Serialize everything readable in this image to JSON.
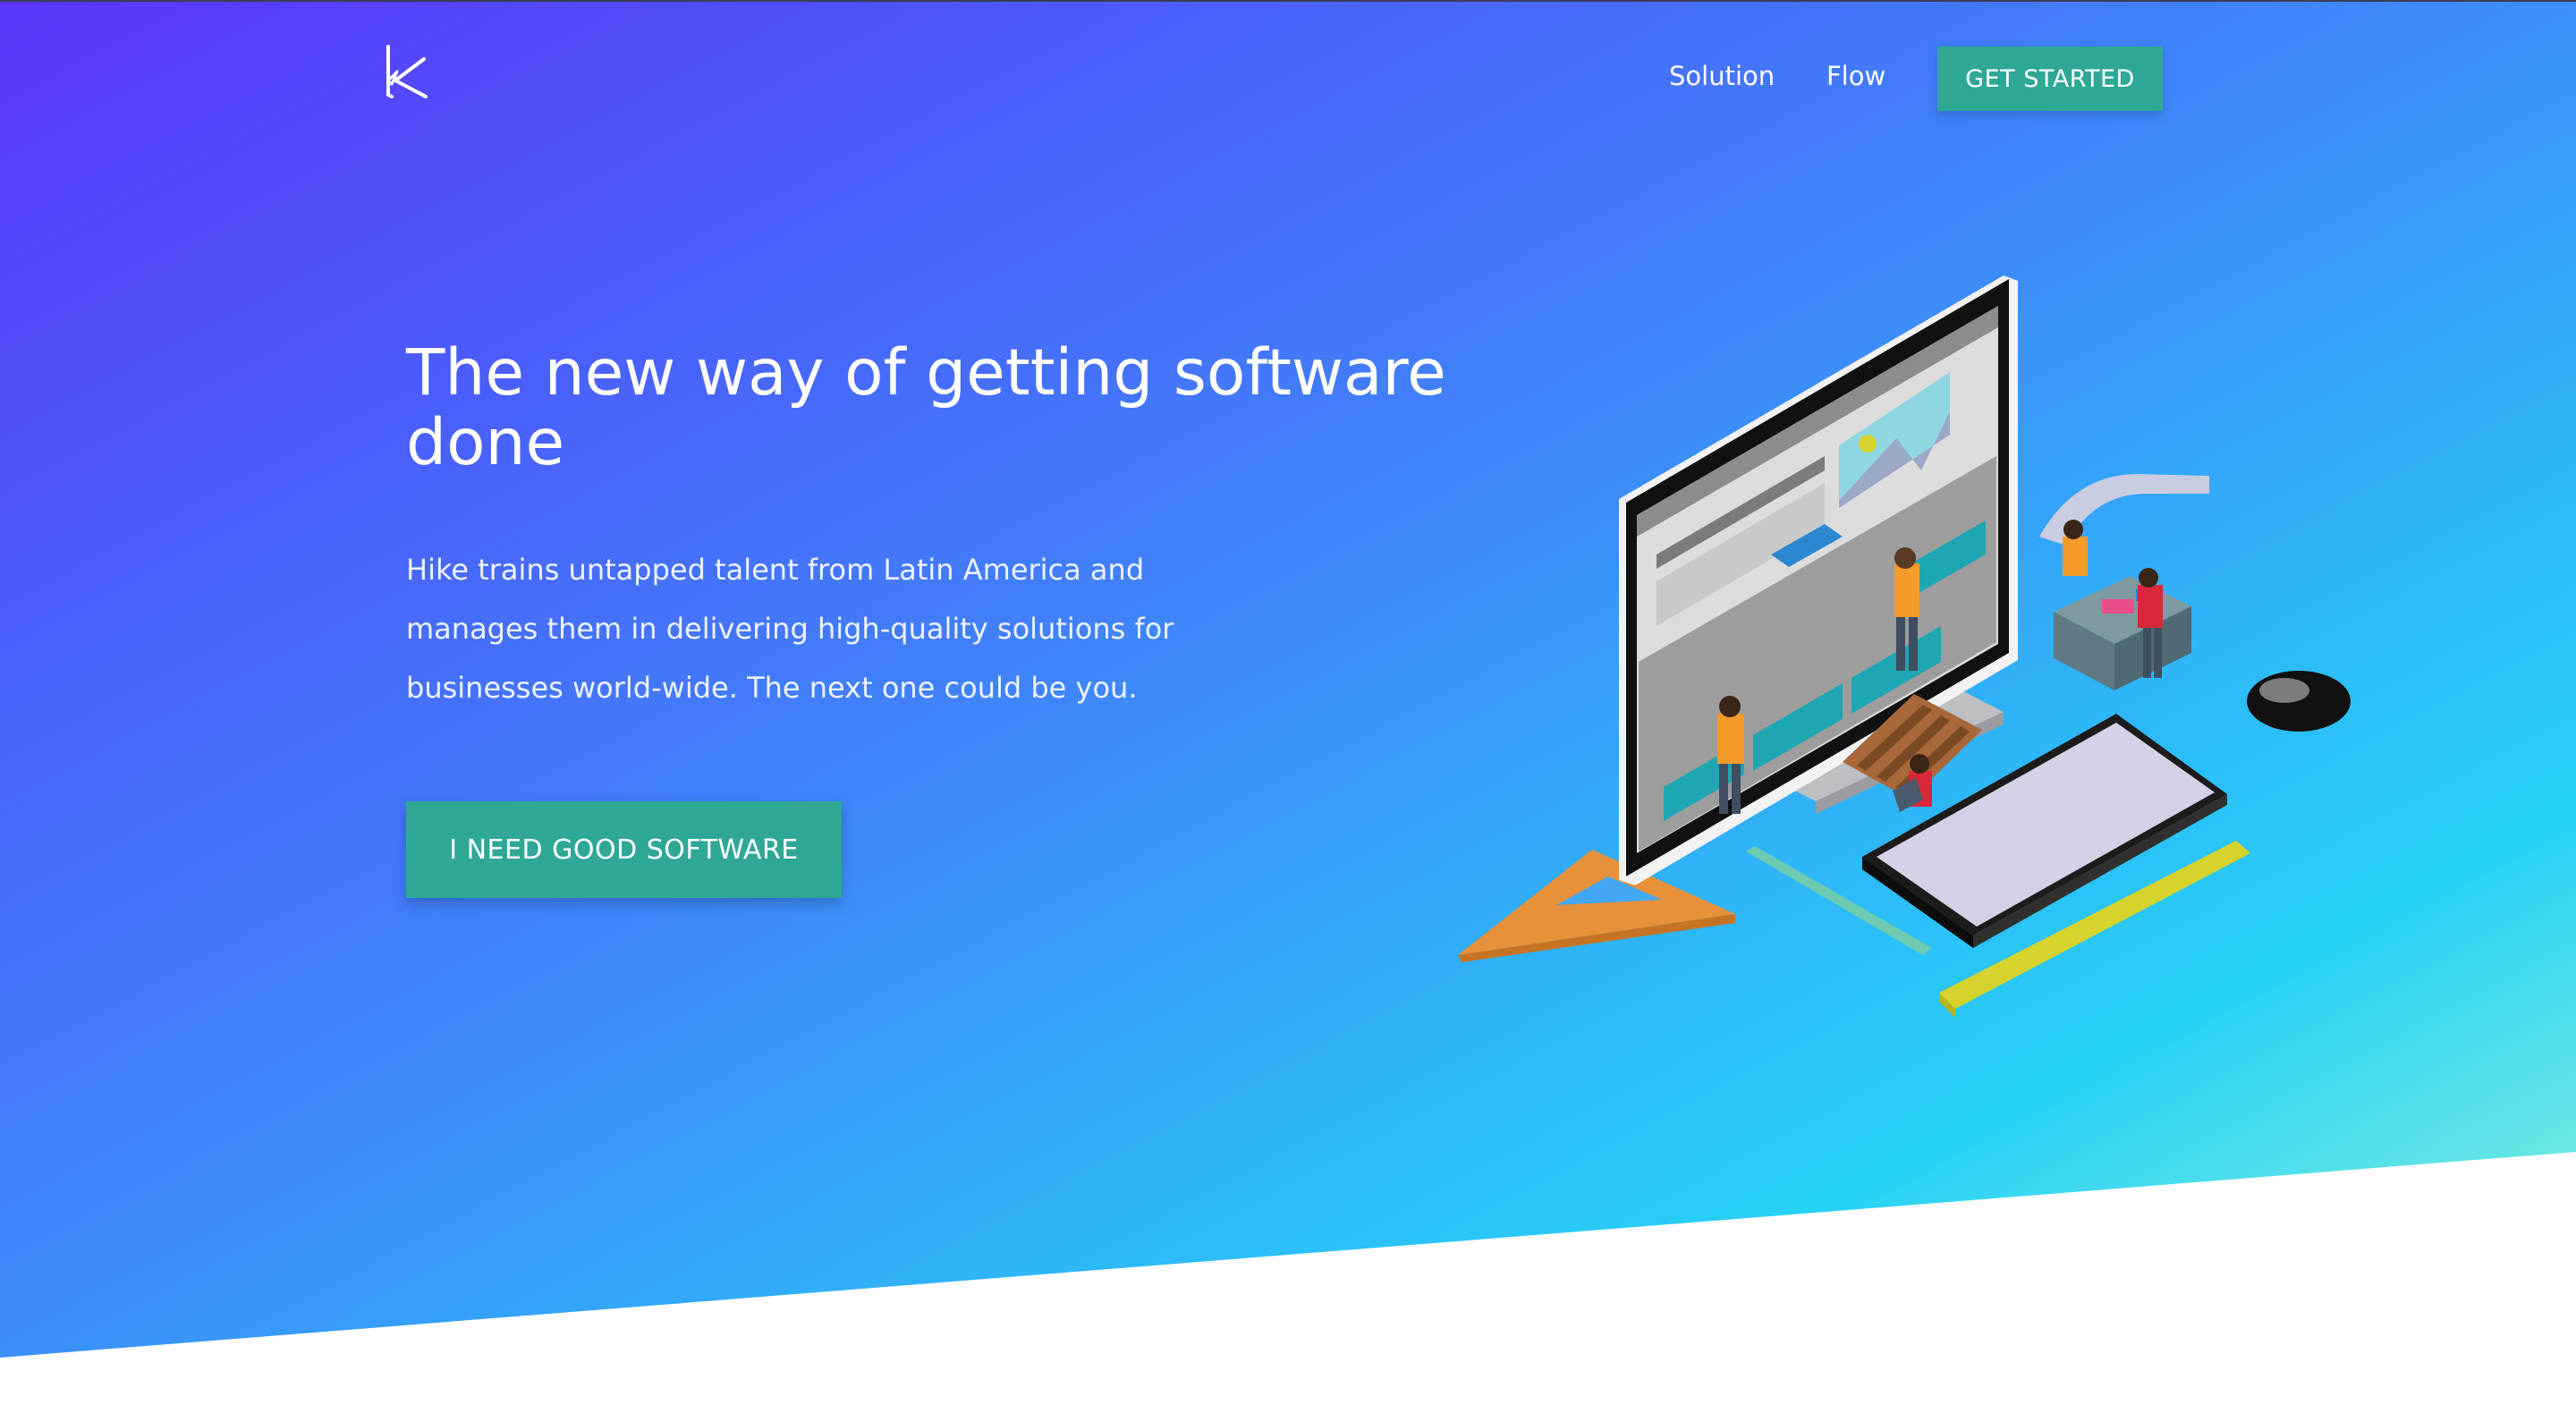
{
  "brand": {
    "logo_icon": "hike-k-logo-icon"
  },
  "nav": {
    "links": [
      "Solution",
      "Flow"
    ],
    "cta_label": "GET STARTED"
  },
  "hero": {
    "title": "The new way of getting software done",
    "description": "Hike trains untapped talent from Latin America and manages them in delivering high-quality solutions for businesses world-wide. The next one could be you.",
    "cta_label": "I NEED GOOD SOFTWARE",
    "illustration_icon": "isometric-computer-workshop-illustration"
  },
  "colors": {
    "gradient_start": "#5a35f8",
    "gradient_mid": "#2fb6f8",
    "gradient_end": "#94f6d4",
    "button": "#2fa896"
  }
}
